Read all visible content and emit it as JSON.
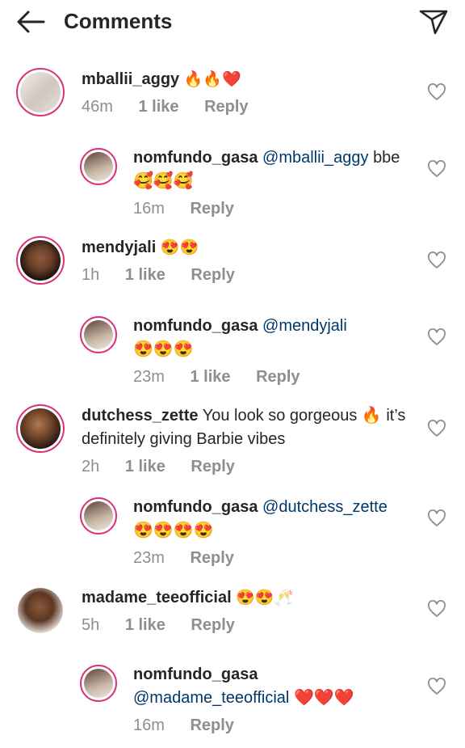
{
  "header": {
    "title": "Comments"
  },
  "comments": [
    {
      "user": "mballii_aggy",
      "mention": "",
      "text": "🔥🔥❤️",
      "time": "46m",
      "likes": "1 like",
      "reply": "Reply"
    },
    {
      "user": "nomfundo_gasa",
      "mention": "@mballii_aggy",
      "text": "bbe 🥰🥰🥰",
      "time": "16m",
      "likes": "",
      "reply": "Reply"
    },
    {
      "user": "mendyjali",
      "mention": "",
      "text": "😍😍",
      "time": "1h",
      "likes": "1 like",
      "reply": "Reply"
    },
    {
      "user": "nomfundo_gasa",
      "mention": "@mendyjali",
      "text": "😍😍😍",
      "time": "23m",
      "likes": "1 like",
      "reply": "Reply"
    },
    {
      "user": "dutchess_zette",
      "mention": "",
      "text": "You look so gorgeous 🔥 it’s definitely giving Barbie vibes",
      "time": "2h",
      "likes": "1 like",
      "reply": "Reply"
    },
    {
      "user": "nomfundo_gasa",
      "mention": "@dutchess_zette",
      "text": "😍😍😍😍",
      "time": "23m",
      "likes": "",
      "reply": "Reply"
    },
    {
      "user": "madame_teeofficial",
      "mention": "",
      "text": "😍😍🥂",
      "time": "5h",
      "likes": "1 like",
      "reply": "Reply"
    },
    {
      "user": "nomfundo_gasa",
      "mention": "@madame_teeofficial",
      "text": "❤️❤️❤️",
      "time": "16m",
      "likes": "",
      "reply": "Reply"
    }
  ],
  "colors": {
    "mention": "#00376b",
    "meta": "#8e8e8e",
    "ring": "#d8337a"
  }
}
